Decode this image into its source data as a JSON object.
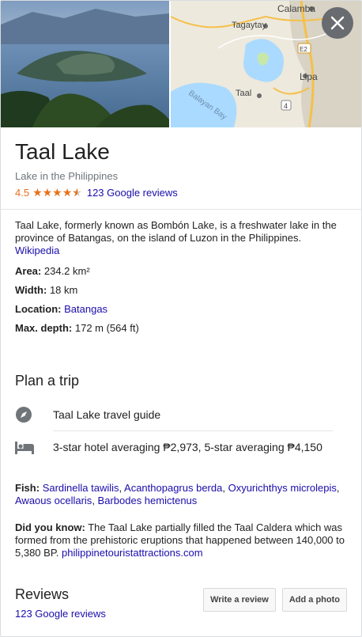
{
  "header": {
    "close_icon": "close-icon",
    "map_labels": {
      "calamba": "Calamba",
      "tagaytay": "Tagaytay",
      "e2": "E2",
      "lipa": "Lipa",
      "taal": "Taal",
      "balayan_bay": "Balayan Bay",
      "route4": "4"
    }
  },
  "place": {
    "title": "Taal Lake",
    "category": "Lake in the Philippines",
    "rating": "4.5",
    "reviews_link": "123 Google reviews"
  },
  "about": {
    "description": "Taal Lake, formerly known as Bombón Lake, is a freshwater lake in the province of Batangas, on the island of Luzon in the Philippines.",
    "source": "Wikipedia"
  },
  "facts": {
    "area_label": "Area:",
    "area_value": "234.2 km²",
    "width_label": "Width:",
    "width_value": "18 km",
    "location_label": "Location:",
    "location_value": "Batangas",
    "depth_label": "Max. depth:",
    "depth_value": "172 m (564 ft)"
  },
  "plan": {
    "title": "Plan a trip",
    "items": [
      {
        "label": "Taal Lake travel guide",
        "icon": "compass-icon"
      },
      {
        "label": "3-star hotel averaging ₱2,973, 5-star averaging ₱4,150",
        "icon": "hotel-bed-icon"
      }
    ]
  },
  "fish": {
    "label": "Fish:",
    "items": [
      "Sardinella tawilis",
      "Acanthopagrus berda",
      "Oxyurichthys microlepis",
      "Awaous ocellaris",
      "Barbodes hemictenus"
    ]
  },
  "did_you_know": {
    "label": "Did you know:",
    "text": "The Taal Lake partially filled the Taal Caldera which was formed from the prehistoric eruptions that happened between 140,000 to 5,380 BP.",
    "source": "philippinetouristattractions.com"
  },
  "reviews": {
    "title": "Reviews",
    "link": "123 Google reviews",
    "write_button": "Write a review",
    "photo_button": "Add a photo"
  },
  "colors": {
    "star": "#e7711b",
    "link": "#1a0dab",
    "muted": "#70757a"
  }
}
